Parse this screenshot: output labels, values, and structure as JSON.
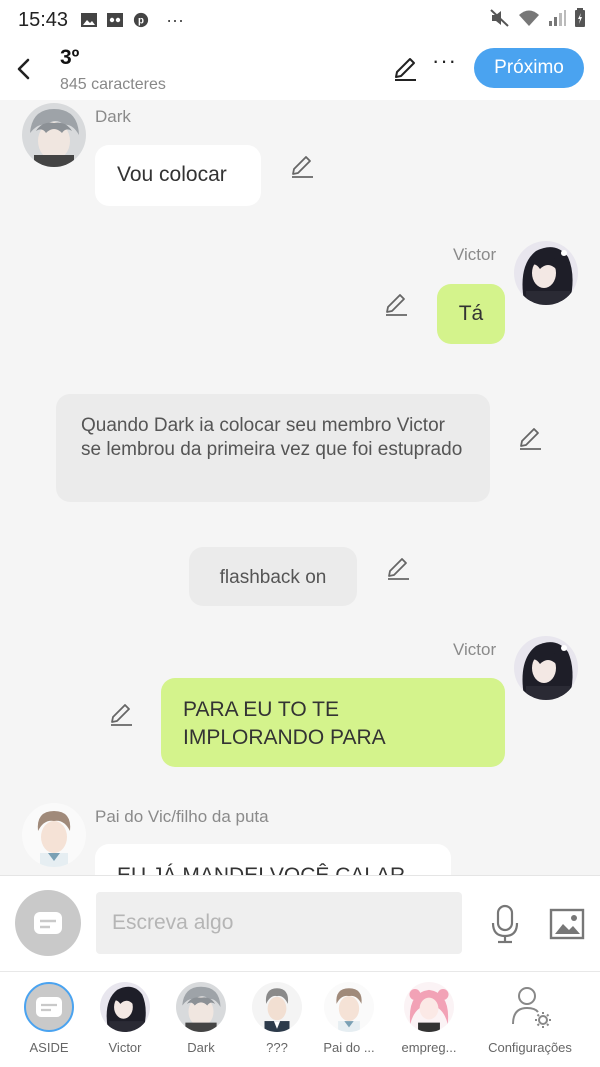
{
  "status_bar": {
    "time": "15:43",
    "overflow": "···"
  },
  "header": {
    "title": "3º",
    "subtitle": "845 caracteres",
    "next_label": "Próximo",
    "more_label": "···"
  },
  "messages": [
    {
      "sender": "Dark",
      "text": "Vou colocar",
      "side": "left"
    },
    {
      "sender": "Victor",
      "text": "Tá",
      "side": "right"
    },
    {
      "sender": "",
      "text": "Quando Dark ia colocar seu membro Victor se lembrou da primeira vez que foi estuprado",
      "side": "narration"
    },
    {
      "sender": "",
      "text": "flashback on",
      "side": "narration"
    },
    {
      "sender": "Victor",
      "text": "PARA EU TO TE IMPLORANDO PARA",
      "side": "right"
    },
    {
      "sender": "Pai do Vic/filho da puta",
      "text": "EU JÁ MANDEI VOCÊ CALAR",
      "side": "left"
    }
  ],
  "input": {
    "placeholder": "Escreva algo"
  },
  "characters": [
    {
      "label": "ASIDE"
    },
    {
      "label": "Victor"
    },
    {
      "label": "Dark"
    },
    {
      "label": "???"
    },
    {
      "label": "Pai do ..."
    },
    {
      "label": "empreg..."
    },
    {
      "label": "Configurações"
    }
  ],
  "colors": {
    "accent": "#4aa3f0",
    "green_bubble": "#d4f38c",
    "narration_bubble": "#ebebeb"
  },
  "icons": [
    "back-arrow-icon",
    "edit-pencil-icon",
    "more-icon",
    "mic-icon",
    "image-icon",
    "chat-icon",
    "settings-user-icon"
  ]
}
